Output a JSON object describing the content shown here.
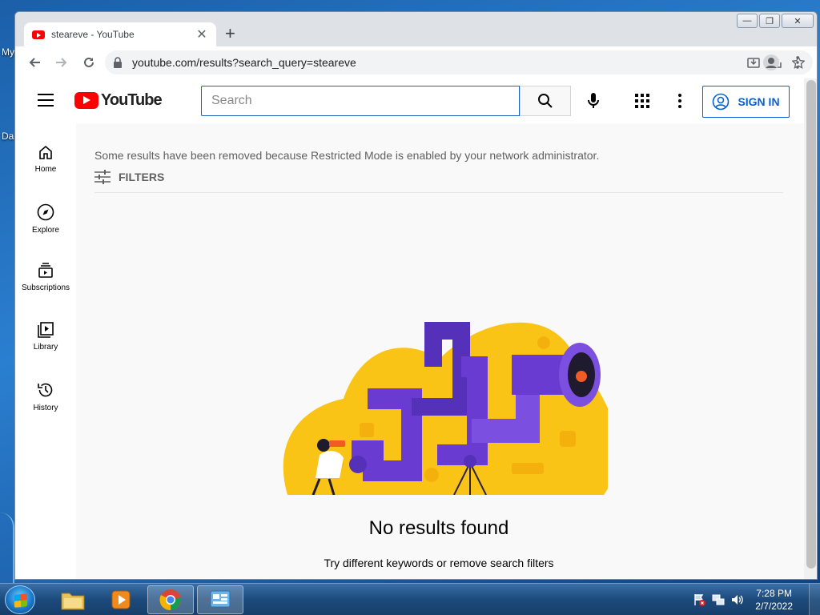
{
  "desktop": {
    "labels": [
      "My",
      "Da"
    ]
  },
  "browser": {
    "tab": {
      "title": "steareve - YouTube",
      "close": "✕"
    },
    "new_tab": "+",
    "window_controls": {
      "minimize": "—",
      "restore": "❐",
      "close": "✕"
    },
    "url": "youtube.com/results?search_query=steareve"
  },
  "youtube": {
    "logo_text": "YouTube",
    "search": {
      "placeholder": "Search",
      "value": ""
    },
    "sign_in": "SIGN IN",
    "guide": [
      {
        "label": "Home",
        "icon": "home-icon"
      },
      {
        "label": "Explore",
        "icon": "compass-icon"
      },
      {
        "label": "Subscriptions",
        "icon": "subscriptions-icon"
      },
      {
        "label": "Library",
        "icon": "library-icon"
      },
      {
        "label": "History",
        "icon": "history-icon"
      }
    ],
    "restricted_notice": "Some results have been removed because Restricted Mode is enabled by your network administrator.",
    "filters_label": "FILTERS",
    "empty_title": "No results found",
    "empty_subtitle": "Try different keywords or remove search filters"
  },
  "taskbar": {
    "clock_time": "7:28 PM",
    "clock_date": "2/7/2022"
  },
  "colors": {
    "youtube_red": "#ff0000",
    "link_blue": "#065fd4",
    "illustration_yellow": "#f9c416",
    "illustration_purple": "#6a3bd1"
  }
}
